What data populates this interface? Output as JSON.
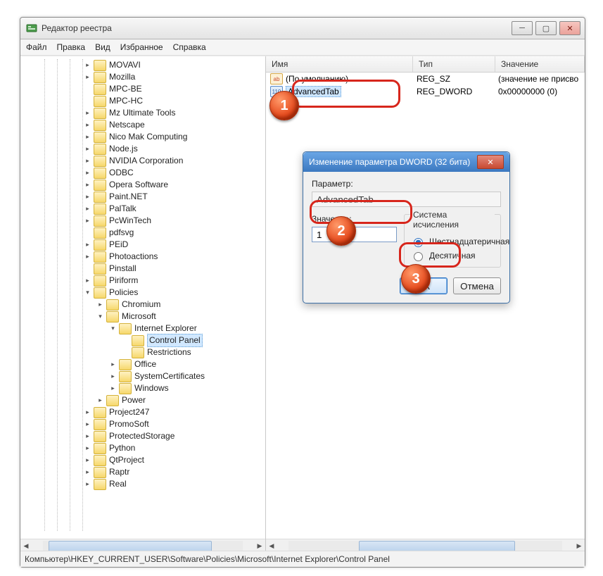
{
  "window": {
    "title": "Редактор реестра"
  },
  "menu": {
    "file": "Файл",
    "edit": "Правка",
    "view": "Вид",
    "favorites": "Избранное",
    "help": "Справка"
  },
  "tree": {
    "items": [
      {
        "depth": 5,
        "expand": "closed",
        "label": "MOVAVI"
      },
      {
        "depth": 5,
        "expand": "closed",
        "label": "Mozilla"
      },
      {
        "depth": 5,
        "expand": "leaf",
        "label": "MPC-BE"
      },
      {
        "depth": 5,
        "expand": "leaf",
        "label": "MPC-HC"
      },
      {
        "depth": 5,
        "expand": "closed",
        "label": "Mz Ultimate Tools"
      },
      {
        "depth": 5,
        "expand": "closed",
        "label": "Netscape"
      },
      {
        "depth": 5,
        "expand": "closed",
        "label": "Nico Mak Computing"
      },
      {
        "depth": 5,
        "expand": "closed",
        "label": "Node.js"
      },
      {
        "depth": 5,
        "expand": "closed",
        "label": "NVIDIA Corporation"
      },
      {
        "depth": 5,
        "expand": "closed",
        "label": "ODBC"
      },
      {
        "depth": 5,
        "expand": "closed",
        "label": "Opera Software"
      },
      {
        "depth": 5,
        "expand": "closed",
        "label": "Paint.NET"
      },
      {
        "depth": 5,
        "expand": "closed",
        "label": "PalTalk"
      },
      {
        "depth": 5,
        "expand": "closed",
        "label": "PcWinTech"
      },
      {
        "depth": 5,
        "expand": "leaf",
        "label": "pdfsvg"
      },
      {
        "depth": 5,
        "expand": "closed",
        "label": "PEiD"
      },
      {
        "depth": 5,
        "expand": "closed",
        "label": "Photoactions"
      },
      {
        "depth": 5,
        "expand": "leaf",
        "label": "Pinstall"
      },
      {
        "depth": 5,
        "expand": "closed",
        "label": "Piriform"
      },
      {
        "depth": 5,
        "expand": "open",
        "label": "Policies"
      },
      {
        "depth": 6,
        "expand": "closed",
        "label": "Chromium"
      },
      {
        "depth": 6,
        "expand": "open",
        "label": "Microsoft"
      },
      {
        "depth": 7,
        "expand": "open",
        "label": "Internet Explorer"
      },
      {
        "depth": 8,
        "expand": "leaf",
        "label": "Control Panel",
        "selected": true
      },
      {
        "depth": 8,
        "expand": "leaf",
        "label": "Restrictions"
      },
      {
        "depth": 7,
        "expand": "closed",
        "label": "Office"
      },
      {
        "depth": 7,
        "expand": "closed",
        "label": "SystemCertificates"
      },
      {
        "depth": 7,
        "expand": "closed",
        "label": "Windows"
      },
      {
        "depth": 6,
        "expand": "closed",
        "label": "Power"
      },
      {
        "depth": 5,
        "expand": "closed",
        "label": "Project247"
      },
      {
        "depth": 5,
        "expand": "closed",
        "label": "PromoSoft"
      },
      {
        "depth": 5,
        "expand": "closed",
        "label": "ProtectedStorage"
      },
      {
        "depth": 5,
        "expand": "closed",
        "label": "Python"
      },
      {
        "depth": 5,
        "expand": "closed",
        "label": "QtProject"
      },
      {
        "depth": 5,
        "expand": "closed",
        "label": "Raptr"
      },
      {
        "depth": 5,
        "expand": "closed",
        "label": "Real"
      }
    ]
  },
  "list": {
    "cols": {
      "name": "Имя",
      "type": "Тип",
      "value": "Значение"
    },
    "rows": [
      {
        "icon": "sz",
        "name": "(По умолчанию)",
        "type": "REG_SZ",
        "value": "(значение не присво"
      },
      {
        "icon": "dw",
        "name": "AdvancedTab",
        "type": "REG_DWORD",
        "value": "0x00000000 (0)",
        "selected": true
      }
    ]
  },
  "dialog": {
    "title": "Изменение параметра DWORD (32 бита)",
    "param_label": "Параметр:",
    "param_value": "AdvancedTab",
    "value_label": "Значение:",
    "value_input": "1",
    "base_group": "Система исчисления",
    "radio_hex": "Шестнадцатеричная",
    "radio_dec": "Десятичная",
    "ok": "ОК",
    "cancel": "Отмена"
  },
  "status": {
    "path": "Компьютер\\HKEY_CURRENT_USER\\Software\\Policies\\Microsoft\\Internet Explorer\\Control Panel"
  },
  "callouts": {
    "c1": "1",
    "c2": "2",
    "c3": "3"
  }
}
